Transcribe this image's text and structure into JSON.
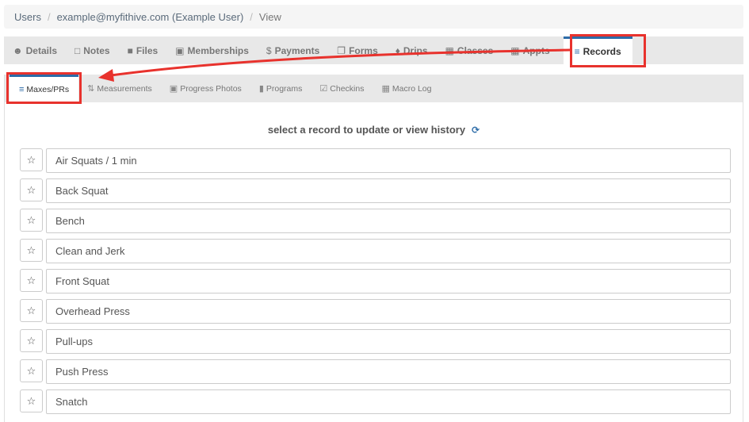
{
  "breadcrumb": {
    "items": [
      "Users",
      "example@myfithive.com (Example User)",
      "View"
    ]
  },
  "main_tabs": [
    {
      "label": "Details",
      "icon": "user-circle-icon"
    },
    {
      "label": "Notes",
      "icon": "note-icon"
    },
    {
      "label": "Files",
      "icon": "folder-icon"
    },
    {
      "label": "Memberships",
      "icon": "id-card-icon"
    },
    {
      "label": "Payments",
      "icon": "dollar-icon"
    },
    {
      "label": "Forms",
      "icon": "copy-icon"
    },
    {
      "label": "Drips",
      "icon": "drop-icon"
    },
    {
      "label": "Classes",
      "icon": "calendar-icon"
    },
    {
      "label": "Appts",
      "icon": "calendar-icon"
    },
    {
      "label": "Records",
      "icon": "list-ol-icon",
      "active": true
    }
  ],
  "sub_tabs": [
    {
      "label": "Maxes/PRs",
      "icon": "list-ol-icon",
      "active": true
    },
    {
      "label": "Measurements",
      "icon": "sort-numeric-icon"
    },
    {
      "label": "Progress Photos",
      "icon": "image-icon"
    },
    {
      "label": "Programs",
      "icon": "book-icon"
    },
    {
      "label": "Checkins",
      "icon": "calendar-check-icon"
    },
    {
      "label": "Macro Log",
      "icon": "calendar-icon"
    }
  ],
  "prompt": "select a record to update or view history",
  "records": [
    "Air Squats / 1 min",
    "Back Squat",
    "Bench",
    "Clean and Jerk",
    "Front Squat",
    "Overhead Press",
    "Pull-ups",
    "Push Press",
    "Snatch"
  ],
  "colors": {
    "accent": "#2d6ca8",
    "annotation": "#e8322d"
  }
}
